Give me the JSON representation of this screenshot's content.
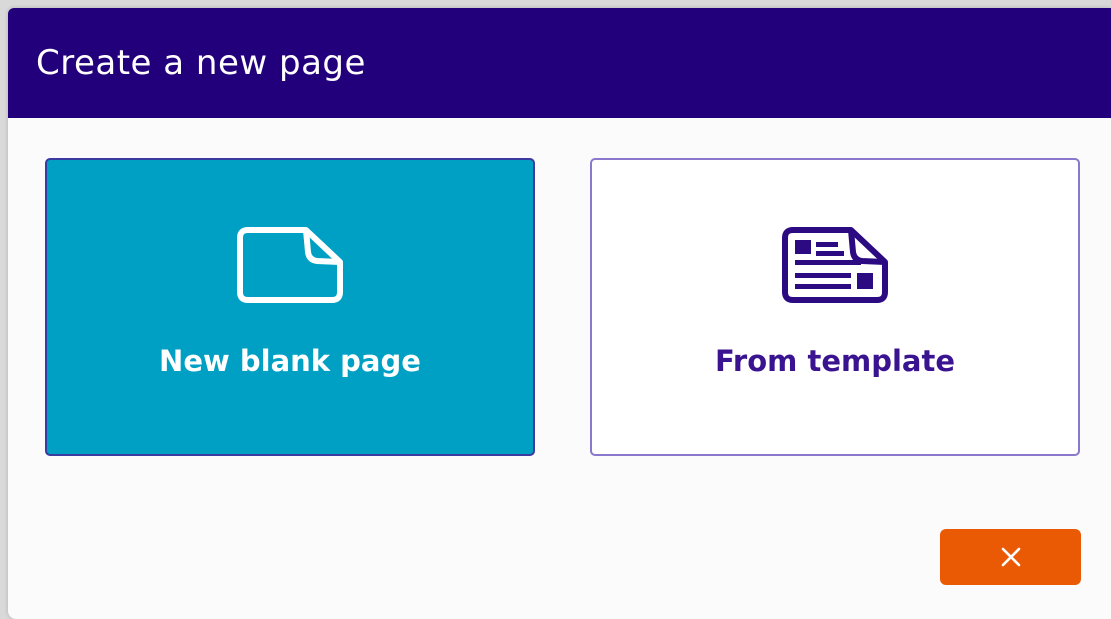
{
  "dialog": {
    "title": "Create a new page",
    "colors": {
      "header": "#23007b",
      "body": "#fbfbfb"
    }
  },
  "options": [
    {
      "label": "New blank page",
      "icon": "blank-page-icon",
      "colors": {
        "background": "#00a0c4",
        "border": "#3b3aa0",
        "text": "#ffffff",
        "icon": "#ffffff"
      }
    },
    {
      "label": "From template",
      "icon": "template-page-icon",
      "colors": {
        "background": "#ffffff",
        "border": "#8a78cc",
        "text": "#3a1391",
        "icon": "#2b0a82"
      }
    }
  ],
  "close": {
    "icon": "close-icon",
    "colors": {
      "background": "#ea5a04",
      "icon": "#ffffff"
    }
  }
}
